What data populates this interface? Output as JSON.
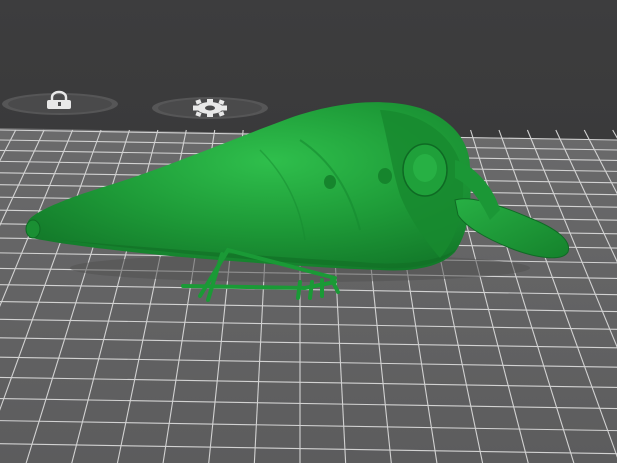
{
  "viewport": {
    "background": "#3a3a3b",
    "bed_color": "#6f6f70",
    "grid_color": "#cfcfcf",
    "model_color": "#1f9a3a"
  },
  "bed_markers": [
    {
      "name": "lock-icon",
      "tooltip": ""
    },
    {
      "name": "gear-icon",
      "tooltip": ""
    }
  ],
  "model": {
    "name": "fishing-lure-model"
  }
}
